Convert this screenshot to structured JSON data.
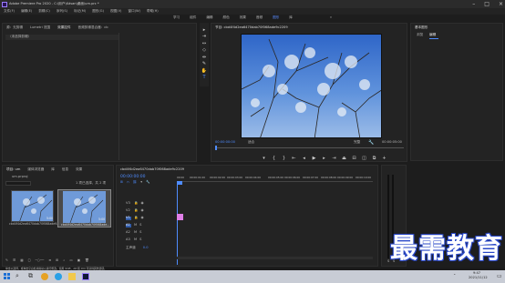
{
  "titlebar": {
    "title": "Adobe Premiere Pro 2020 - C:\\用户\\Kdsan\\桌面\\um.prc *",
    "controls": [
      "–",
      "□",
      "×"
    ]
  },
  "menu": [
    "文件(F)",
    "编辑(E)",
    "剪辑(C)",
    "序列(S)",
    "标记(M)",
    "图形(G)",
    "视图(V)",
    "窗口(W)",
    "帮助(H)"
  ],
  "workspace": {
    "tabs": [
      "学习",
      "组件",
      "编辑",
      "颜色",
      "效果",
      "音频",
      "图形",
      "库"
    ],
    "active_index": 6
  },
  "source_panel": {
    "tabs": [
      "源：无剪辑",
      "Lumetri 范围",
      "效果控件",
      "音频剪辑混合器：cb"
    ],
    "active_index": 2,
    "label": "（未选择剪辑）"
  },
  "program_monitor": {
    "title": "节目: cbd4f4d2ea6470dab70f068ade9c2209",
    "timecode_left": "00:00:00:00",
    "fit": "适合",
    "quality": "完整",
    "timecode_right": "00:00:05:00"
  },
  "right_panel": {
    "title": "基本图形",
    "tabs": [
      "浏览",
      "编辑"
    ],
    "active_index": 1
  },
  "project_panel": {
    "tabs": [
      "项目: um",
      "媒体浏览器",
      "库",
      "信息",
      "效果"
    ],
    "active_index": 0,
    "name": "um.prproj",
    "count": "1 项已选择，共 2 项",
    "items": [
      {
        "name": "cbd4f4d2ea6470dab70f068ade9...",
        "duration": "5:00"
      },
      {
        "name": "cbd4f4d2ea6470dab70f068ade...",
        "duration": "5:00"
      }
    ]
  },
  "timeline": {
    "tab": "cbd4f4d2ea6470dab70f068ade9c2209",
    "timecode": "00:00:00:00",
    "ruler": [
      "00:00",
      "00:00:01:00",
      "00:00:02:00",
      "00:00:03:00",
      "00:00:04:00",
      "00:00:05:00",
      "00:00:06:00",
      "00:00:07:00",
      "00:00:08:00",
      "00:00:09:00",
      "00:00:10:00",
      "00:00:11:00",
      "00:00:12:00"
    ],
    "tracks": [
      "V3",
      "V2",
      "V1",
      "A1",
      "A2",
      "A3"
    ],
    "master": "主声道",
    "master_value": "0.0"
  },
  "status_bar": "单击以选择，或单击空白处并拖动以进行框选。使用 Shift、Alt 和 Ctrl 可获得其他选项。",
  "taskbar": {
    "time": "9:47",
    "date": "2021/11/12"
  },
  "watermark": "最需教育",
  "colors": {
    "accent": "#4f8cff",
    "clip": "#e07fe8",
    "panel": "#232323"
  }
}
